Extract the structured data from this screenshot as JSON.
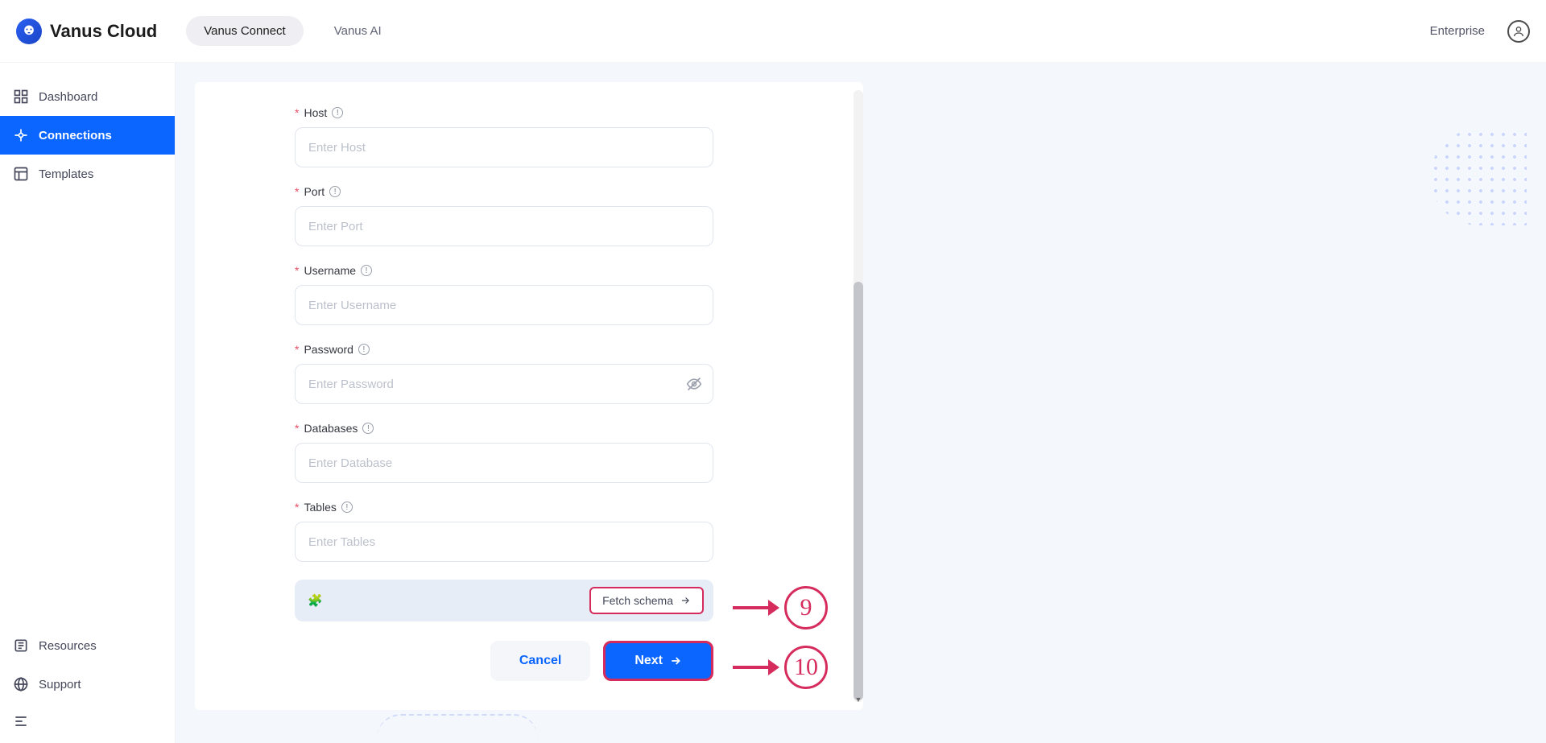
{
  "header": {
    "logo_text": "Vanus Cloud",
    "tabs": {
      "connect": "Vanus Connect",
      "ai": "Vanus AI"
    },
    "enterprise": "Enterprise"
  },
  "sidebar": {
    "dashboard": "Dashboard",
    "connections": "Connections",
    "templates": "Templates",
    "resources": "Resources",
    "support": "Support"
  },
  "form": {
    "required_mark": "*",
    "host": {
      "label": "Host",
      "placeholder": "Enter Host"
    },
    "port": {
      "label": "Port",
      "placeholder": "Enter Port"
    },
    "username": {
      "label": "Username",
      "placeholder": "Enter Username"
    },
    "password": {
      "label": "Password",
      "placeholder": "Enter Password"
    },
    "databases": {
      "label": "Databases",
      "placeholder": "Enter Database"
    },
    "tables": {
      "label": "Tables",
      "placeholder": "Enter Tables"
    },
    "fetch_schema": "Fetch schema",
    "cancel": "Cancel",
    "next": "Next"
  },
  "annotations": {
    "nine": "9",
    "ten": "10"
  }
}
